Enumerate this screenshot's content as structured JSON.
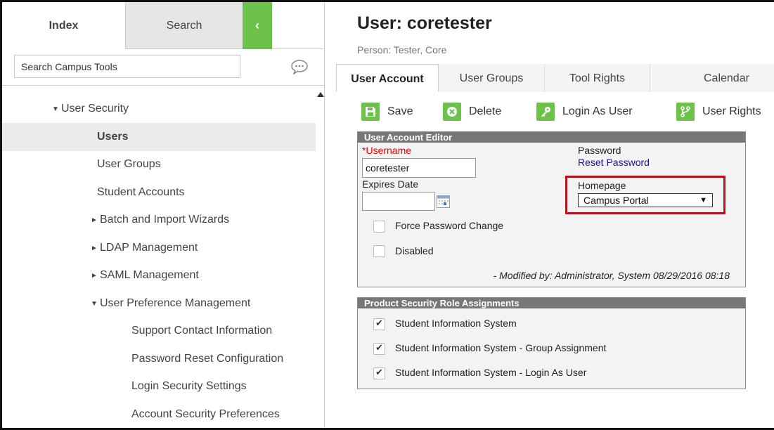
{
  "left_panel": {
    "tabs": {
      "index": "Index",
      "search": "Search",
      "collapse": "‹"
    },
    "search_placeholder": "Search Campus Tools",
    "tree": [
      {
        "label": "User Security",
        "caret": "▼",
        "indent": 1,
        "selected": false
      },
      {
        "label": "Users",
        "caret": "",
        "indent": 2,
        "selected": true
      },
      {
        "label": "User Groups",
        "caret": "",
        "indent": 2,
        "selected": false
      },
      {
        "label": "Student Accounts",
        "caret": "",
        "indent": 2,
        "selected": false
      },
      {
        "label": "Batch and Import Wizards",
        "caret": "►",
        "indent": 2,
        "selected": false
      },
      {
        "label": "LDAP Management",
        "caret": "►",
        "indent": 2,
        "selected": false
      },
      {
        "label": "SAML Management",
        "caret": "►",
        "indent": 2,
        "selected": false
      },
      {
        "label": "User Preference Management",
        "caret": "▼",
        "indent": 2,
        "selected": false
      },
      {
        "label": "Support Contact Information",
        "caret": "",
        "indent": 3,
        "selected": false
      },
      {
        "label": "Password Reset Configuration",
        "caret": "",
        "indent": 3,
        "selected": false
      },
      {
        "label": "Login Security Settings",
        "caret": "",
        "indent": 3,
        "selected": false
      },
      {
        "label": "Account Security Preferences",
        "caret": "",
        "indent": 3,
        "selected": false
      }
    ]
  },
  "header": {
    "title": "User: coretester",
    "subtitle": "Person: Tester, Core"
  },
  "tabs": [
    "User Account",
    "User Groups",
    "Tool Rights",
    "Calendar"
  ],
  "toolbar": {
    "save": "Save",
    "delete": "Delete",
    "login_as_user": "Login As User",
    "user_rights": "User Rights"
  },
  "account_editor": {
    "title": "User Account Editor",
    "username_required_mark": "*",
    "username_label": "Username",
    "username_value": "coretester",
    "password_label": "Password",
    "reset_password": "Reset Password",
    "expires_label": "Expires Date",
    "expires_value": "",
    "homepage_label": "Homepage",
    "homepage_value": "Campus Portal",
    "force_password_change": "Force Password Change",
    "force_password_change_checked": false,
    "disabled": "Disabled",
    "disabled_checked": false,
    "modified": "- Modified by: Administrator, System 08/29/2016 08:18"
  },
  "role_assignments": {
    "title": "Product Security Role Assignments",
    "items": [
      {
        "label": "Student Information System",
        "checked": true
      },
      {
        "label": "Student Information System - Group Assignment",
        "checked": true
      },
      {
        "label": "Student Information System - Login As User",
        "checked": true
      }
    ]
  },
  "colors": {
    "accent_green": "#6cc24a",
    "highlight_red": "#b8121d",
    "panel_header": "#777777",
    "required_red": "#ee0000",
    "link_blue": "#1a0dab"
  }
}
